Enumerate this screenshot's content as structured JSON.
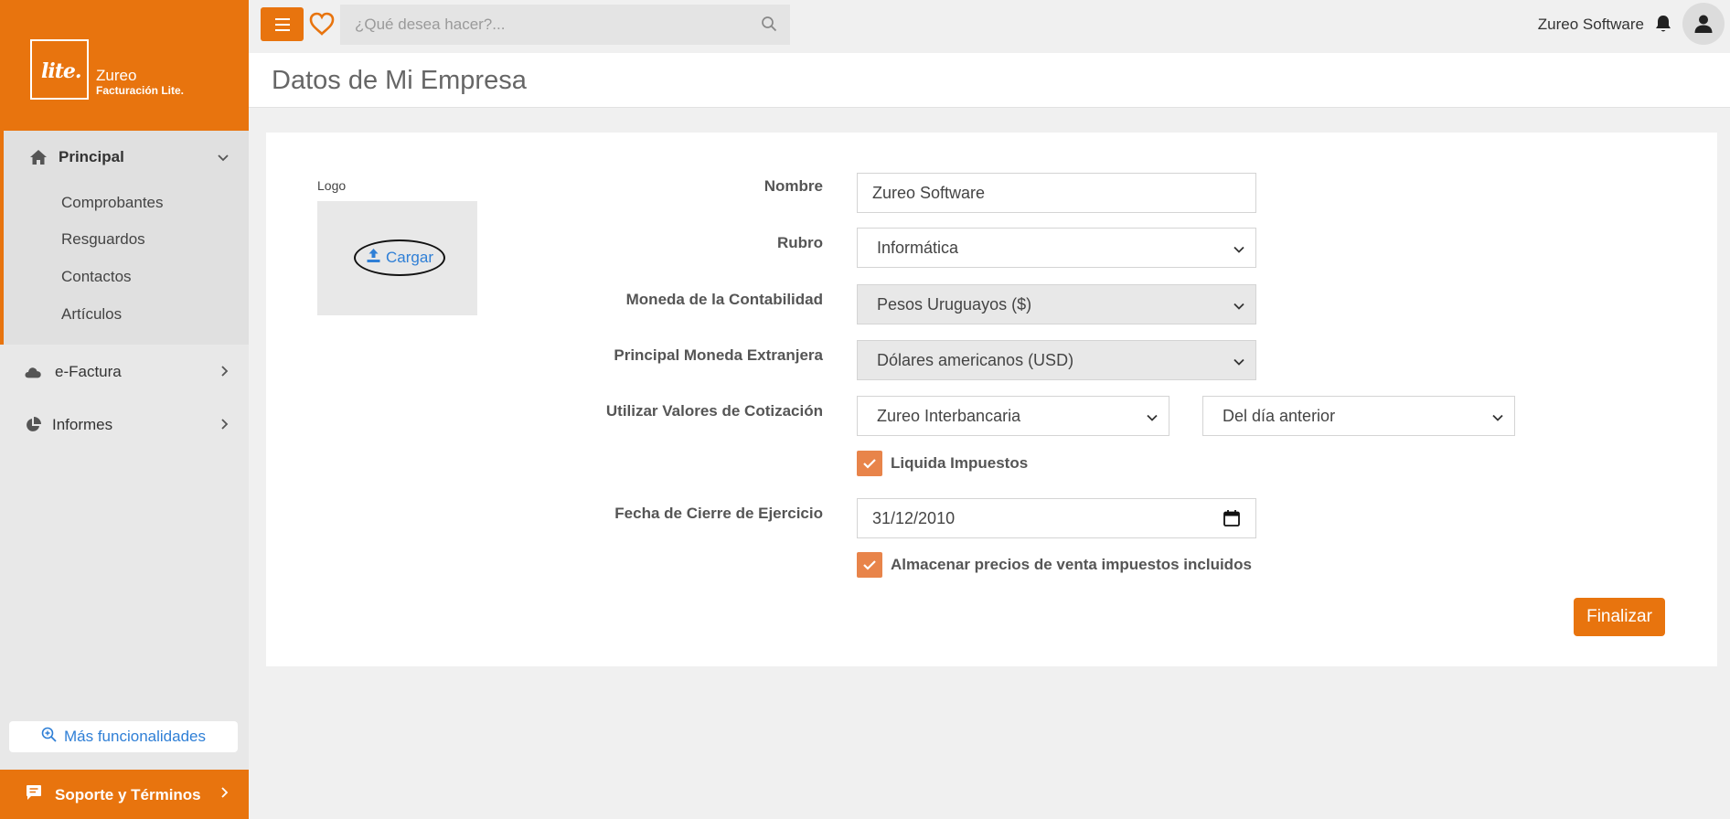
{
  "brand": {
    "logo_text": "lite.",
    "name": "Zureo",
    "subtitle": "Facturación Lite."
  },
  "sidebar": {
    "principal": {
      "label": "Principal",
      "items": [
        {
          "label": "Comprobantes"
        },
        {
          "label": "Resguardos"
        },
        {
          "label": "Contactos"
        },
        {
          "label": "Artículos"
        }
      ]
    },
    "efactura": {
      "label": "e-Factura"
    },
    "informes": {
      "label": "Informes"
    },
    "more_label": "Más funcionalidades",
    "support_label": "Soporte y Términos"
  },
  "topbar": {
    "search_placeholder": "¿Qué desea hacer?...",
    "user_name": "Zureo Software"
  },
  "page": {
    "title": "Datos de Mi Empresa"
  },
  "form": {
    "logo_label": "Logo",
    "upload_label": "Cargar",
    "nombre_label": "Nombre",
    "nombre_value": "Zureo Software",
    "rubro_label": "Rubro",
    "rubro_value": "Informática",
    "moneda_label": "Moneda de la Contabilidad",
    "moneda_value": "Pesos Uruguayos ($)",
    "moneda_ext_label": "Principal Moneda Extranjera",
    "moneda_ext_value": "Dólares americanos (USD)",
    "cotizacion_label": "Utilizar Valores de Cotización",
    "cotizacion_source": "Zureo Interbancaria",
    "cotizacion_day": "Del día anterior",
    "liquida_label": "Liquida Impuestos",
    "liquida_checked": true,
    "fecha_label": "Fecha de Cierre de Ejercicio",
    "fecha_value": "31/12/2010",
    "almacenar_label": "Almacenar precios de venta impuestos incluidos",
    "almacenar_checked": true,
    "finish_label": "Finalizar"
  },
  "colors": {
    "accent": "#e8740e",
    "checkbox": "#e8844a",
    "link": "#2f7fd6"
  }
}
